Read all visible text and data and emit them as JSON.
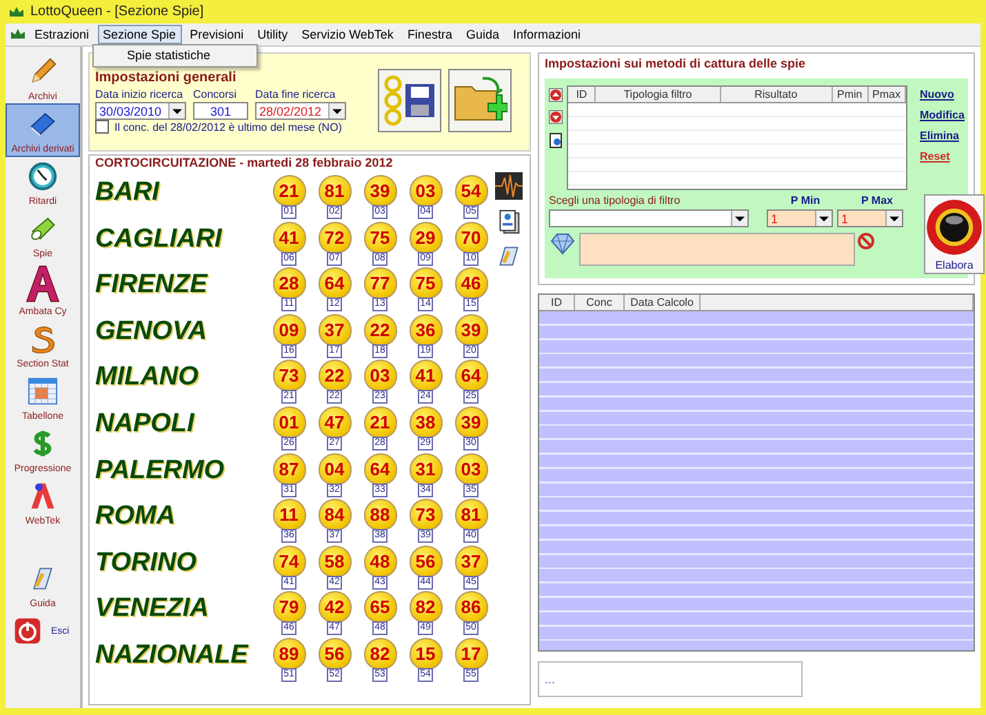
{
  "window": {
    "title": "LottoQueen - [Sezione Spie]"
  },
  "menu": [
    {
      "label": "Estrazioni",
      "selected": false
    },
    {
      "label": "Sezione Spie",
      "selected": true
    },
    {
      "label": "Previsioni",
      "selected": false
    },
    {
      "label": "Utility",
      "selected": false
    },
    {
      "label": "Servizio WebTek",
      "selected": false
    },
    {
      "label": "Finestra",
      "selected": false
    },
    {
      "label": "Guida",
      "selected": false
    },
    {
      "label": "Informazioni",
      "selected": false
    }
  ],
  "dropdown": {
    "items": [
      "Spie statistiche"
    ]
  },
  "sidebar": {
    "items": [
      {
        "label": "Archivi",
        "kind": "pencil",
        "selected": false
      },
      {
        "label": "Archivi derivati",
        "kind": "book",
        "selected": true
      },
      {
        "label": "Ritardi",
        "kind": "clock",
        "selected": false
      },
      {
        "label": "Spie",
        "kind": "torch",
        "selected": false
      },
      {
        "label": "Ambata Cy",
        "kind": "letter",
        "selected": false
      },
      {
        "label": "Section Stat",
        "kind": "s",
        "selected": false
      },
      {
        "label": "Tabellone",
        "kind": "grid",
        "selected": false
      },
      {
        "label": "Progressione",
        "kind": "dollar",
        "selected": false
      },
      {
        "label": "WebTek",
        "kind": "webtek",
        "selected": false
      },
      {
        "label": "Guida",
        "kind": "guide",
        "selected": false
      },
      {
        "label": "Esci",
        "kind": "exit",
        "selected": false
      }
    ]
  },
  "general": {
    "legend": "Impostazioni generali",
    "start_label": "Data inizio ricerca",
    "start_value": "30/03/2010",
    "draws_label": "Concorsi",
    "draws_value": "301",
    "end_label": "Data fine ricerca",
    "end_value": "28/02/2012",
    "last_of_month": {
      "label": "Il conc. del 28/02/2012 è ultimo del mese (NO)",
      "checked": false
    }
  },
  "draw": {
    "legend": "CORTOCIRCUITAZIONE - martedi 28 febbraio 2012",
    "wheels": [
      {
        "name": "BARI",
        "numbers": [
          "21",
          "81",
          "39",
          "03",
          "54"
        ],
        "positions": [
          "01",
          "02",
          "03",
          "04",
          "05"
        ]
      },
      {
        "name": "CAGLIARI",
        "numbers": [
          "41",
          "72",
          "75",
          "29",
          "70"
        ],
        "positions": [
          "06",
          "07",
          "08",
          "09",
          "10"
        ]
      },
      {
        "name": "FIRENZE",
        "numbers": [
          "28",
          "64",
          "77",
          "75",
          "46"
        ],
        "positions": [
          "11",
          "12",
          "13",
          "14",
          "15"
        ]
      },
      {
        "name": "GENOVA",
        "numbers": [
          "09",
          "37",
          "22",
          "36",
          "39"
        ],
        "positions": [
          "16",
          "17",
          "18",
          "19",
          "20"
        ]
      },
      {
        "name": "MILANO",
        "numbers": [
          "73",
          "22",
          "03",
          "41",
          "64"
        ],
        "positions": [
          "21",
          "22",
          "23",
          "24",
          "25"
        ]
      },
      {
        "name": "NAPOLI",
        "numbers": [
          "01",
          "47",
          "21",
          "38",
          "39"
        ],
        "positions": [
          "26",
          "27",
          "28",
          "29",
          "30"
        ]
      },
      {
        "name": "PALERMO",
        "numbers": [
          "87",
          "04",
          "64",
          "31",
          "03"
        ],
        "positions": [
          "31",
          "32",
          "33",
          "34",
          "35"
        ]
      },
      {
        "name": "ROMA",
        "numbers": [
          "11",
          "84",
          "88",
          "73",
          "81"
        ],
        "positions": [
          "36",
          "37",
          "38",
          "39",
          "40"
        ]
      },
      {
        "name": "TORINO",
        "numbers": [
          "74",
          "58",
          "48",
          "56",
          "37"
        ],
        "positions": [
          "41",
          "42",
          "43",
          "44",
          "45"
        ]
      },
      {
        "name": "VENEZIA",
        "numbers": [
          "79",
          "42",
          "65",
          "82",
          "86"
        ],
        "positions": [
          "46",
          "47",
          "48",
          "49",
          "50"
        ]
      },
      {
        "name": "NAZIONALE",
        "numbers": [
          "89",
          "56",
          "82",
          "15",
          "17"
        ],
        "positions": [
          "51",
          "52",
          "53",
          "54",
          "55"
        ]
      }
    ]
  },
  "spy": {
    "legend": "Impostazioni sui metodi di cattura delle spie",
    "columns": [
      "ID",
      "Tipologia filtro",
      "Risultato",
      "Pmin",
      "Pmax"
    ],
    "links": [
      {
        "label": "Nuovo",
        "kind": "normal"
      },
      {
        "label": "Modifica",
        "kind": "normal"
      },
      {
        "label": "Elimina",
        "kind": "normal"
      },
      {
        "label": "Reset",
        "kind": "danger"
      }
    ],
    "filter_label": "Scegli una tipologia di filtro",
    "pmin_label": "P Min",
    "pmin_value": "1",
    "pmax_label": "P Max",
    "pmax_value": "1",
    "run_label": "Elabora"
  },
  "results": {
    "columns": [
      "ID",
      "Conc",
      "Data Calcolo"
    ]
  },
  "status": {
    "text": "..."
  }
}
